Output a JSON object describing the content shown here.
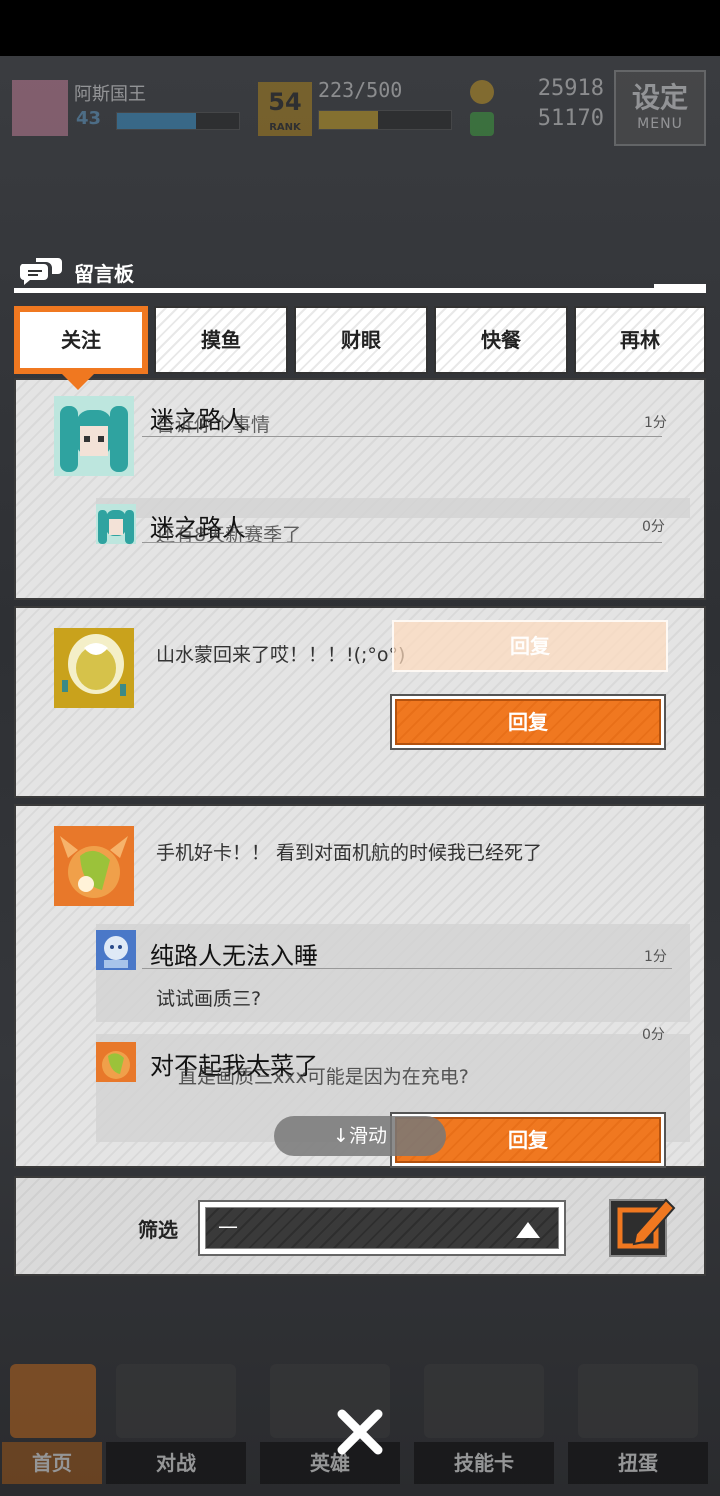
{
  "hud": {
    "player_name": "阿斯国王",
    "player_level": "43",
    "xp_progress": 0.65,
    "rank_number": "54",
    "rank_label": "RANK",
    "rank_count": "223/500",
    "rank_progress": 0.45,
    "coins": "25918",
    "gems": "51170",
    "menu_title": "设定",
    "menu_sub": "MENU"
  },
  "board": {
    "title": "留言板",
    "tabs": [
      "关注",
      "摸鱼",
      "财眼",
      "快餐",
      "再林"
    ],
    "active_tab": 0
  },
  "posts": [
    {
      "author": "迷之路人",
      "message": "告诉你个事情",
      "time": "1分",
      "replies": [
        {
          "author": "迷之路人",
          "message": "还有8天新赛季了",
          "time": "0分"
        }
      ]
    },
    {
      "message": "山水蒙回来了哎！！！!(;°o°)",
      "ghost_reply_label": "回复",
      "reply_label": "回复"
    },
    {
      "message": "手机好卡！！ 看到对面机航的时候我已经死了",
      "replies": [
        {
          "author": "纯路人无法入睡",
          "message": "试试画质三?",
          "time": "1分"
        },
        {
          "author": "对不起我太菜了",
          "message": "直是画质三xxx可能是因为在充电?",
          "time": "0分"
        }
      ],
      "reply_label": "回复"
    }
  ],
  "scroll_hint": "↓滑动",
  "filter": {
    "label": "筛选",
    "value": "—"
  },
  "nav": {
    "items": [
      "首页",
      "对战",
      "英雄",
      "技能卡",
      "扭蛋"
    ]
  },
  "colors": {
    "accent": "#f07820",
    "panel": "#e0e0e0",
    "dark": "#2e2e2e"
  }
}
